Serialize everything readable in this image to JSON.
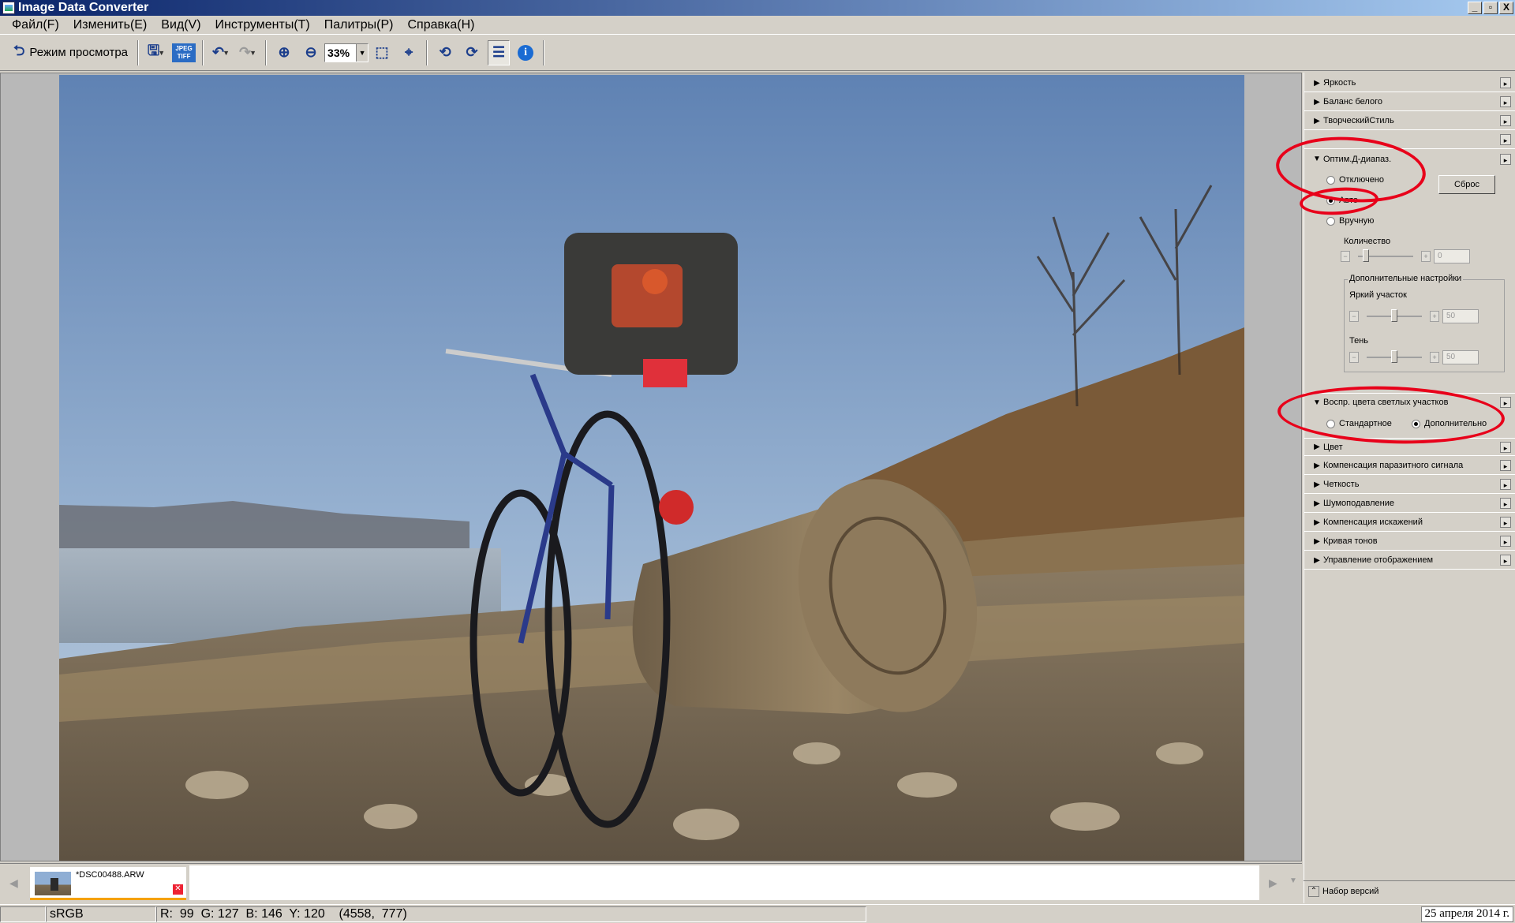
{
  "window": {
    "title": "Image Data Converter",
    "buttons": [
      "_",
      "▫",
      "X"
    ]
  },
  "menu": [
    "Файл(F)",
    "Изменить(E)",
    "Вид(V)",
    "Инструменты(T)",
    "Палитры(P)",
    "Справка(H)"
  ],
  "toolbar": {
    "view_mode_label": "Режим просмотра",
    "jpeg_tiff_label": "JPEG TIFF",
    "zoom_value": "33%"
  },
  "panel": {
    "sections_top": [
      "Яркость",
      "Баланс белого",
      "ТворческийСтиль",
      ""
    ],
    "dro": {
      "title": "Оптим.Д-диапаз.",
      "options": [
        "Отключено",
        "Авто",
        "Вручную"
      ],
      "selected": "Авто",
      "reset_label": "Сброс",
      "amount_label": "Количество",
      "amount_value": "0",
      "advanced_legend": "Дополнительные настройки",
      "highlight_label": "Яркий участок",
      "highlight_value": "50",
      "shadow_label": "Тень",
      "shadow_value": "50"
    },
    "highlight_color": {
      "title": "Воспр. цвета светлых участков",
      "options": [
        "Стандартное",
        "Дополнительно"
      ],
      "selected": "Дополнительно"
    },
    "sections_bottom": [
      "Цвет",
      "Компенсация паразитного сигнала",
      "Четкость",
      "Шумоподавление",
      "Компенсация искажений",
      "Кривая тонов",
      "Управление отображением"
    ],
    "versions_label": "Набор версий"
  },
  "filmstrip": {
    "file_name": "*DSC00488.ARW"
  },
  "status": {
    "color_space": "sRGB",
    "pixel_info": "R:  99  G: 127  B: 146  Y: 120    (4558,  777)",
    "date": "25 апреля 2014 г."
  },
  "colors": {
    "annotation_red": "#e8001a",
    "title_gradient_start": "#0a246a"
  }
}
